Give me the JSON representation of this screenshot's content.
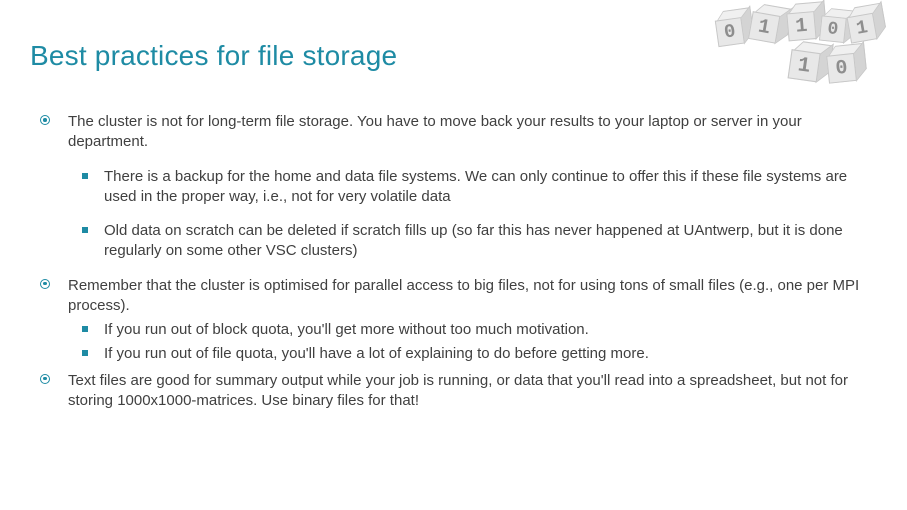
{
  "title": "Best practices for file storage",
  "bullets": [
    {
      "text": "The cluster is not for long-term file storage. You have to move back your results to your laptop or server in your department.",
      "sub": [
        "There is a backup for the home and data file systems. We can only continue to offer this if these file systems are used in the proper way, i.e., not for very volatile data",
        "Old data on scratch can be deleted if scratch fills up (so far this has never happened at UAntwerp, but it is done regularly on some other VSC clusters)"
      ]
    },
    {
      "text": "Remember that the cluster is optimised for parallel access to big files, not for using tons of small files (e.g., one per MPI process).",
      "sub_tight": [
        "If you run out of block quota, you'll get more without too much motivation.",
        "If you run out of file quota, you'll have a lot of explaining to do before getting more."
      ]
    },
    {
      "text": "Text files are good for summary output while your job is running, or data that you'll read into a spreadsheet, but not for storing 1000x1000-matrices. Use binary files for that!"
    }
  ],
  "decor_digits": [
    "0",
    "1",
    "1",
    "0",
    "1",
    "1",
    "0"
  ]
}
